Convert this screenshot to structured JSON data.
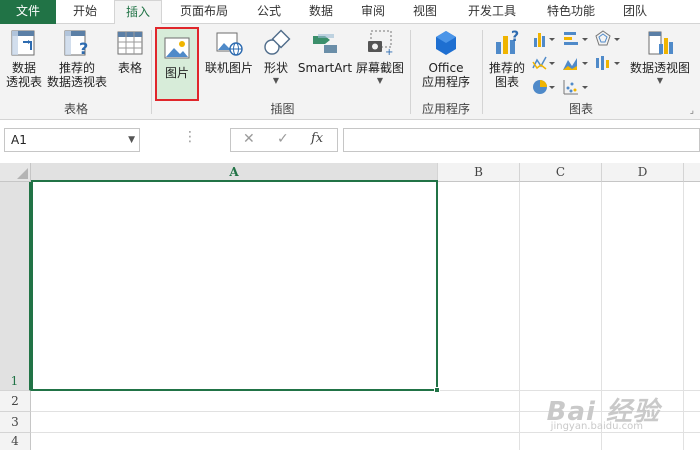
{
  "tabs": [
    "文件",
    "开始",
    "插入",
    "页面布局",
    "公式",
    "数据",
    "审阅",
    "视图",
    "开发工具",
    "特色功能",
    "团队"
  ],
  "active_tab": "插入",
  "ribbon": {
    "pivot_table": "数据\n透视表",
    "recommended_pivot": "推荐的\n数据透视表",
    "table": "表格",
    "picture": "图片",
    "online_picture": "联机图片",
    "shapes": "形状",
    "smartart": "SmartArt",
    "screenshot": "屏幕截图",
    "office_apps": "Office\n应用程序",
    "recommended_charts": "推荐的\n图表",
    "pivot_chart": "数据透视图",
    "groups": {
      "tables": "表格",
      "illustrations": "插图",
      "apps": "应用程序",
      "charts": "图表"
    }
  },
  "formula_bar": {
    "name_box": "A1",
    "fx": "fx",
    "cancel": "✕",
    "enter": "✓",
    "value": ""
  },
  "grid": {
    "columns": [
      "A",
      "B",
      "C",
      "D"
    ],
    "rows": [
      "1",
      "2",
      "3",
      "4"
    ],
    "selected_cell": "A1"
  },
  "watermark": {
    "brand": "Bai 经验",
    "url": "jingyan.baidu.com"
  },
  "colors": {
    "accent": "#217346",
    "highlight": "#e0262b"
  }
}
